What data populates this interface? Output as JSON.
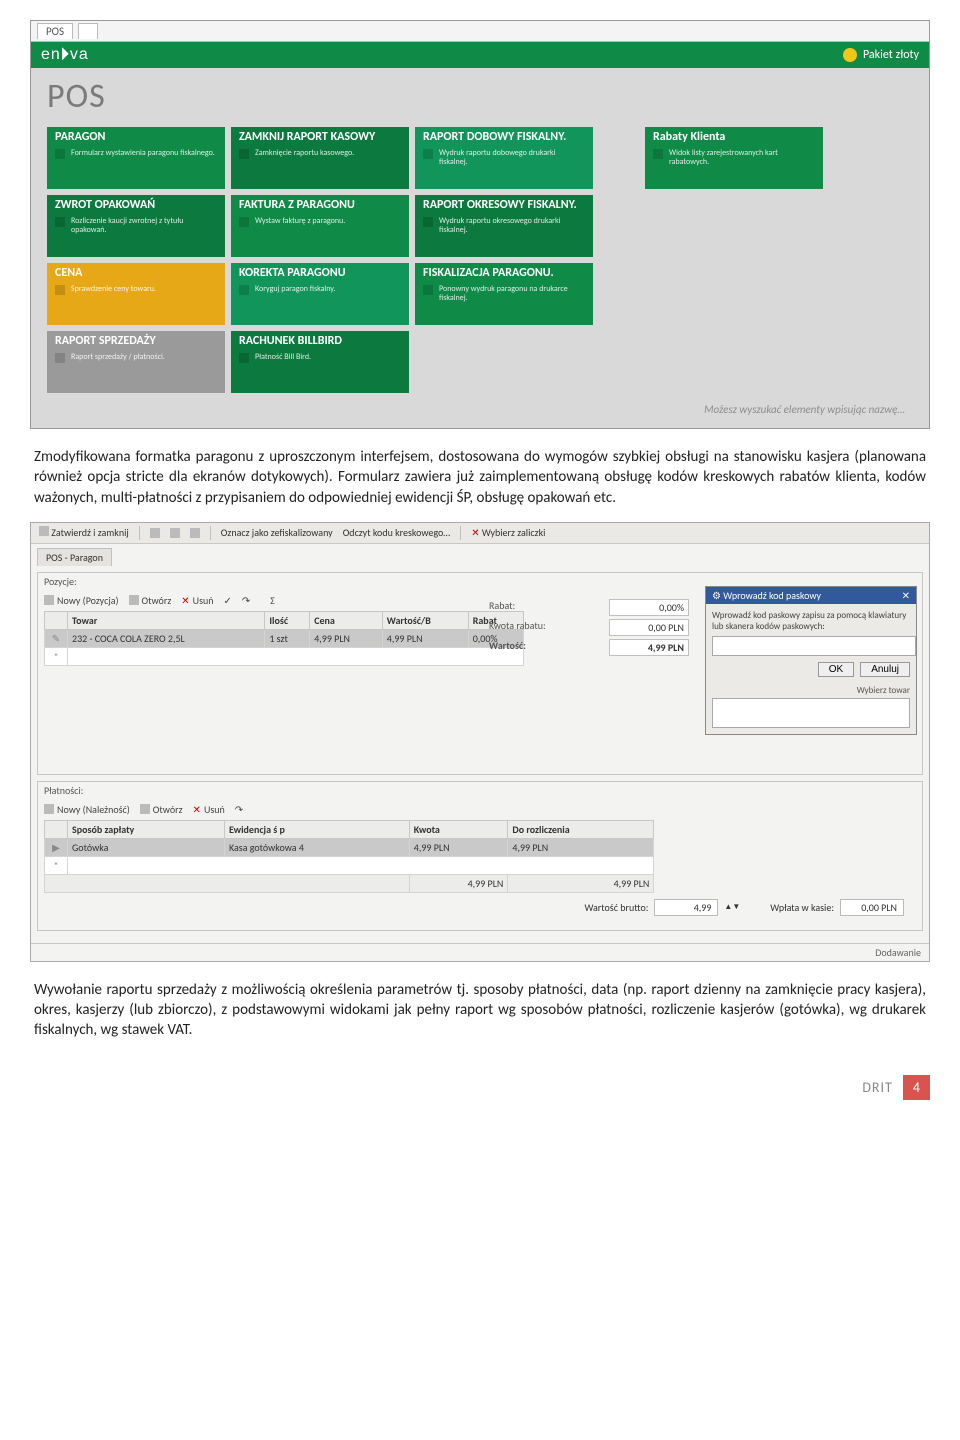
{
  "shot1": {
    "windowTab": "POS",
    "brand": "enova",
    "packageLabel": "Pakiet złoty",
    "title": "POS",
    "hint": "Możesz wyszukać elementy wpisując nazwę…",
    "tiles": [
      {
        "title": "PARAGON",
        "desc": "Formularz wystawienia paragonu fiskalnego.",
        "cls": "green"
      },
      {
        "title": "ZAMKNIJ RAPORT KASOWY",
        "desc": "Zamknięcie raportu kasowego.",
        "cls": "green2"
      },
      {
        "title": "RAPORT DOBOWY FISKALNY.",
        "desc": "Wydruk raportu dobowego drukarki fiskalnej.",
        "cls": "green3"
      },
      {
        "title": "Rabaty Klienta",
        "desc": "Widok listy zarejestrowanych kart rabatowych.",
        "cls": "green"
      },
      {
        "title": "ZWROT OPAKOWAŃ",
        "desc": "Rozliczenie kaucji zwrotnej z tytułu opakowań.",
        "cls": "green2"
      },
      {
        "title": "FAKTURA Z PARAGONU",
        "desc": "Wystaw fakturę z paragonu.",
        "cls": "green"
      },
      {
        "title": "RAPORT OKRESOWY FISKALNY.",
        "desc": "Wydruk raportu okresowego drukarki fiskalnej.",
        "cls": "green2"
      },
      {
        "title": "CENA",
        "desc": "Sprawdzenie ceny towaru.",
        "cls": "orange"
      },
      {
        "title": "KOREKTA PARAGONU",
        "desc": "Koryguj paragon fiskalny.",
        "cls": "green3"
      },
      {
        "title": "FISKALIZACJA PARAGONU.",
        "desc": "Ponowny wydruk paragonu na drukarce fiskalnej.",
        "cls": "green"
      },
      {
        "title": "RAPORT SPRZEDAŻY",
        "desc": "Raport sprzedaży / płatności.",
        "cls": "gray"
      },
      {
        "title": "RACHUNEK BILLBIRD",
        "desc": "Płatność Bill Bird.",
        "cls": "green2"
      }
    ]
  },
  "para1": "Zmodyfikowana formatka paragonu z uproszczonym interfejsem, dostosowana do wymogów szybkiej obsługi na stanowisku kasjera (planowana również opcja stricte dla ekranów dotykowych). Formularz zawiera już zaimplementowaną obsługę kodów kreskowych rabatów klienta, kodów ważonych, multi-płatności z przypisaniem do odpowiedniej ewidencji ŚP, obsługę opakowań etc.",
  "shot2": {
    "toolbar": {
      "save": "Zatwierdź i zamknij",
      "mark": "Oznacz jako zefiskalizowany",
      "scan": "Odczyt kodu kreskowego…",
      "sel": "Wybierz zaliczki"
    },
    "tab": "POS - Paragon",
    "positions": {
      "groupLabel": "Pozycje:",
      "miniToolbar": {
        "new": "Nowy (Pozycja)",
        "open": "Otwórz",
        "del": "Usuń"
      },
      "cols": {
        "towar": "Towar",
        "ilosc": "Ilość",
        "cena": "Cena",
        "wartosc": "Wartość/B",
        "rabat": "Rabat"
      },
      "row": {
        "towar": "232 - COCA COLA ZERO 2,5L",
        "ilosc": "1 szt",
        "cena": "4,99 PLN",
        "wartosc": "4,99 PLN",
        "rabat": "0,00%"
      }
    },
    "summary": {
      "rabatLbl": "Rabat:",
      "rabatVal": "0,00%",
      "kwotaLbl": "Kwota rabatu:",
      "kwotaVal": "0,00 PLN",
      "wartoscLbl": "Wartość:",
      "wartoscVal": "4,99 PLN"
    },
    "barcode": {
      "title": "Wprowadź kod paskowy",
      "hint": "Wprowadź kod paskowy zapisu za pomocą klawiatury lub skanera kodów paskowych:",
      "ok": "OK",
      "cancel": "Anuluj",
      "selLabel": "Wybierz towar"
    },
    "payments": {
      "groupLabel": "Płatności:",
      "miniToolbar": {
        "new": "Nowy (Należność)",
        "open": "Otwórz",
        "del": "Usuń"
      },
      "cols": {
        "sposob": "Sposób zapłaty",
        "ewid": "Ewidencja ś p",
        "kwota": "Kwota",
        "rozl": "Do rozliczenia"
      },
      "row": {
        "sposob": "Gotówka",
        "ewid": "Kasa gotówkowa 4",
        "kwota": "4,99 PLN",
        "rozl": "4,99 PLN"
      },
      "totals": {
        "kwota": "4,99 PLN",
        "rozl": "4,99 PLN"
      }
    },
    "footer": {
      "bruttoLbl": "Wartość brutto:",
      "bruttoVal": "4,99",
      "kasaLbl": "Wpłata w kasie:",
      "kasaVal": "0,00 PLN"
    },
    "status": "Dodawanie"
  },
  "para2": "Wywołanie raportu sprzedaży z możliwością określenia parametrów tj. sposoby płatności, data (np. raport dzienny na zamknięcie pracy kasjera), okres, kasjerzy (lub zbiorczo), z podstawowymi widokami jak pełny raport wg sposobów płatności, rozliczenie kasjerów (gotówka), wg drukarek fiskalnych, wg stawek VAT.",
  "footer": {
    "drit": "DRIT",
    "page": "4"
  }
}
